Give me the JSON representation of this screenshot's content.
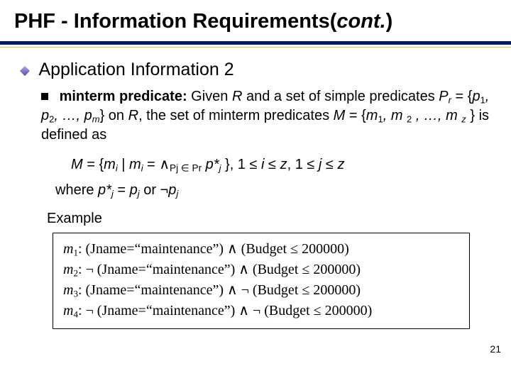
{
  "title": {
    "main": "PHF - Information Requirements(",
    "cont": "cont.",
    "close": ")"
  },
  "section": "Application Information 2",
  "para": {
    "lead": "minterm predicate:",
    "t1": " Given ",
    "R": "R",
    "t2": " and a set of simple predicates ",
    "Pr": "P",
    "Prsub": "r",
    "eq1": " = {",
    "p": "p",
    "s1": "1",
    "c1": ", ",
    "s2": "2",
    "c2": ", …, ",
    "sm": "m",
    "eq2": "} on ",
    "R2": "R",
    "t3": ", the set of minterm predicates ",
    "M": "M",
    "eq3": " = {",
    "m": "m",
    "ms1": "1",
    "mc1": ", ",
    "m2": "m ",
    "ms2": "2",
    "mc2": " , …, ",
    "m3": "m ",
    "msz": "z",
    "eq4": " } is defined as"
  },
  "def": {
    "M": "M ",
    "eq": " = {",
    "mi": "m",
    "isub": "i",
    "bar": " | ",
    "mi2": "m",
    "isub2": "i",
    "eq2": " = ",
    "wedge": "∧",
    "psub": "Pj ∈ Pr",
    "sp": " ",
    "pstar": "p*",
    "jsub": "j",
    "close": " }, 1 ",
    "le": "≤",
    "i": " i ",
    "le2": "≤",
    "z": " z",
    "comma": ", 1 ",
    "le3": "≤",
    "j": " j ",
    "le4": "≤",
    "z2": " z"
  },
  "where": {
    "pre": "where ",
    "pstar": "p*",
    "j": "j",
    "eq": " = ",
    "p": "p",
    "j2": "j",
    "or": "  or  ¬",
    "p2": "p",
    "j3": "j"
  },
  "exampleLabel": "Example",
  "ex": {
    "m": "m",
    "s1": "1",
    "s2": "2",
    "s3": "3",
    "s4": "4",
    "colon": ":",
    "r1": "  (Jname=“maintenance”)   ∧ (Budget ≤ 200000)",
    "r2": "  ¬ (Jname=“maintenance”) ∧ (Budget ≤ 200000)",
    "r3": "  (Jname=“maintenance”)   ∧ ¬ (Budget ≤ 200000)",
    "r4": "  ¬ (Jname=“maintenance”) ∧ ¬ (Budget ≤ 200000)"
  },
  "slidenum": "21"
}
